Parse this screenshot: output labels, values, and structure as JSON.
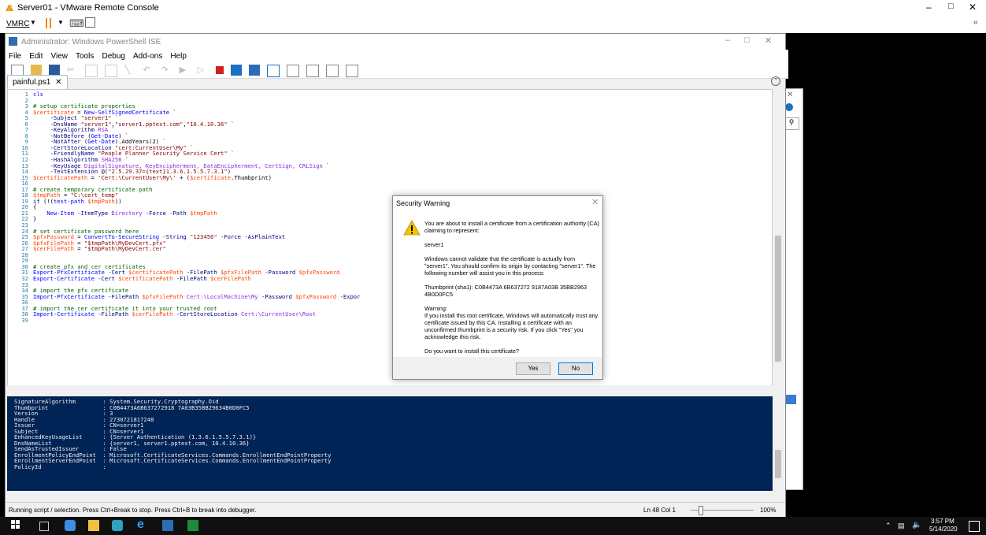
{
  "vmrc": {
    "window_title": "Server01 - VMware Remote Console",
    "menu_label": "VMRC"
  },
  "ise": {
    "window_title": "Administrator: Windows PowerShell ISE",
    "menu": [
      "File",
      "Edit",
      "View",
      "Tools",
      "Debug",
      "Add-ons",
      "Help"
    ],
    "tab_label": "painful.ps1",
    "line_numbers": "1\n2\n3\n4\n5\n6\n7\n8\n9\n10\n11\n12\n13\n14\n15\n16\n17\n18\n19\n20\n21\n22\n23\n24\n25\n26\n27\n28\n29\n30\n31\n32\n33\n34\n35\n36\n37\n38\n39",
    "status_text": "Running script / selection.  Press Ctrl+Break to stop.  Press Ctrl+B to break into debugger.",
    "cursor_pos": "Ln 48  Col 1",
    "zoom": "100%"
  },
  "console": {
    "text": "SignatureAlgorithm        : System.Security.Cryptography.Oid\nThumbprint                : C0B4473A6B637272918 7A03B35BB29634B0D0FC5\nVersion                   : 3\nHandle                    : 2730721817248\nIssuer                    : CN=server1\nSubject                   : CN=server1\nEnhancedKeyUsageList      : {Server Authentication (1.3.6.1.5.5.7.3.1)}\nDnsNameList               : {server1, server1.pptest.com, 10.4.10.36}\nSendAsTrustedIssuer       : False\nEnrollmentPolicyEndPoint  : Microsoft.CertificateServices.Commands.EnrollmentEndPointProperty\nEnrollmentServerEndPoint  : Microsoft.CertificateServices.Commands.EnrollmentEndPointProperty\nPolicyId                  :"
  },
  "dialog": {
    "title": "Security Warning",
    "p1": "You are about to install a certificate from a certification authority (CA) claiming to represent:",
    "p2": "server1",
    "p3": "Windows cannot validate that the certificate is actually from \"server1\". You should confirm its origin by contacting \"server1\". The following number will assist you in this process:",
    "p4": "Thumbprint (sha1): C0B4473A 6B637272 9187A03B 35BB2963 4B0D0FC5",
    "p5": "Warning:\nIf you install this root certificate, Windows will automatically trust any certificate issued by this CA. Installing a certificate with an unconfirmed thumbprint is a security risk. If you click \"Yes\" you acknowledge this risk.",
    "p6": "Do you want to install this certificate?",
    "yes_label": "Yes",
    "no_label": "No"
  },
  "taskbar": {
    "time": "3:57 PM",
    "date": "5/14/2020"
  }
}
